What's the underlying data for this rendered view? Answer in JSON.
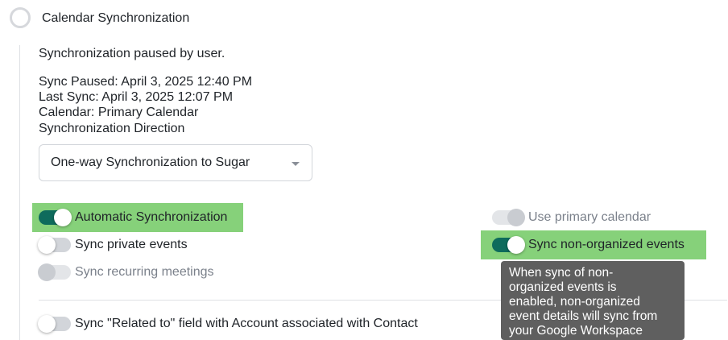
{
  "section": {
    "title": "Calendar Synchronization"
  },
  "status": {
    "message": "Synchronization paused by user.",
    "sync_paused": "Sync Paused: April 3, 2025 12:40 PM",
    "last_sync": "Last Sync: April 3, 2025 12:07 PM",
    "calendar": "Calendar: Primary Calendar",
    "direction_label": "Synchronization Direction"
  },
  "direction_select": {
    "value": "One-way Synchronization to Sugar"
  },
  "toggles": {
    "automatic_sync": {
      "label": "Automatic Synchronization",
      "on": true
    },
    "private_events": {
      "label": "Sync private events",
      "on": false
    },
    "recurring_meetings": {
      "label": "Sync recurring meetings",
      "on": false,
      "disabled": true
    },
    "related_to": {
      "label": "Sync \"Related to\" field with Account associated with Contact",
      "on": false
    },
    "primary_calendar": {
      "label": "Use primary calendar",
      "on": true,
      "disabled": true
    },
    "non_organized": {
      "label": "Sync non-organized events",
      "on": true
    }
  },
  "tooltip": {
    "lines": [
      "When sync of non-",
      "organized events is",
      "enabled, non-organized",
      "event details will sync from",
      "your Google Workspace"
    ]
  },
  "colors": {
    "toggle_on": "#0e6b5c",
    "highlight": "#86d17a",
    "tooltip_bg": "#5f5f5f"
  }
}
